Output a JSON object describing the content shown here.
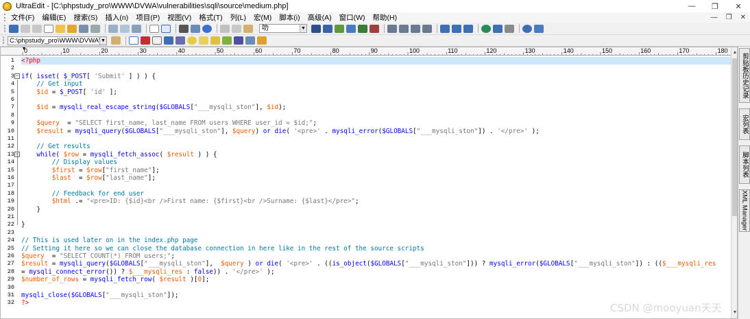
{
  "window": {
    "title": "UltraEdit - [C:\\phpstudy_pro\\WWW\\DVWA\\vulnerabilities\\sqli\\source\\medium.php]",
    "controls": {
      "minimize": "—",
      "restore": "❐",
      "close": "✕"
    }
  },
  "menu": {
    "items": [
      "文件(F)",
      "编辑(E)",
      "搜索(S)",
      "插入(n)",
      "项目(P)",
      "视图(V)",
      "格式(T)",
      "列(L)",
      "宏(M)",
      "脚本(i)",
      "高级(A)",
      "窗口(W)",
      "帮助(H)"
    ],
    "doc_controls": {
      "minimize": "—",
      "restore": "❐",
      "close": "✕"
    }
  },
  "toolbar": {
    "font_select_value": "叻",
    "path_select_value": "C:\\phpstudy_pro\\WWW\\DVWA\\vu"
  },
  "ruler": {
    "labels": [
      "0",
      "10",
      "20",
      "30",
      "40",
      "50",
      "60",
      "70",
      "80",
      "90",
      "100",
      "110",
      "120",
      "130",
      "140",
      "150",
      "160",
      "170",
      "180"
    ]
  },
  "side_tabs": [
    "剪贴板历史记录",
    "宏列表",
    "脚本列表",
    "XML Manager"
  ],
  "code_lines": [
    {
      "n": "1",
      "tokens": [
        {
          "t": "<?php",
          "c": "tag"
        }
      ]
    },
    {
      "n": "2",
      "tokens": []
    },
    {
      "n": "3",
      "tokens": [
        {
          "t": "if",
          "c": "kw"
        },
        {
          "t": "( ",
          "c": "op"
        },
        {
          "t": "isset",
          "c": "fn"
        },
        {
          "t": "( ",
          "c": "op"
        },
        {
          "t": "$_POST",
          "c": "kw"
        },
        {
          "t": "[ ",
          "c": "op"
        },
        {
          "t": "'Submit'",
          "c": "str"
        },
        {
          "t": " ] ) ) {",
          "c": "op"
        }
      ]
    },
    {
      "n": "4",
      "tokens": [
        {
          "t": "    // Get input",
          "c": "cmt"
        }
      ]
    },
    {
      "n": "5",
      "tokens": [
        {
          "t": "    ",
          "c": "op"
        },
        {
          "t": "$id",
          "c": "var"
        },
        {
          "t": " = ",
          "c": "op"
        },
        {
          "t": "$_POST",
          "c": "kw"
        },
        {
          "t": "[ ",
          "c": "op"
        },
        {
          "t": "'id'",
          "c": "str"
        },
        {
          "t": " ];",
          "c": "op"
        }
      ]
    },
    {
      "n": "6",
      "tokens": []
    },
    {
      "n": "7",
      "tokens": [
        {
          "t": "    ",
          "c": "op"
        },
        {
          "t": "$id",
          "c": "var"
        },
        {
          "t": " = ",
          "c": "op"
        },
        {
          "t": "mysqli_real_escape_string",
          "c": "fn"
        },
        {
          "t": "(",
          "c": "op"
        },
        {
          "t": "$GLOBALS",
          "c": "kw"
        },
        {
          "t": "[",
          "c": "op"
        },
        {
          "t": "\"___mysqli_ston\"",
          "c": "str"
        },
        {
          "t": "], ",
          "c": "op"
        },
        {
          "t": "$id",
          "c": "var"
        },
        {
          "t": ");",
          "c": "op"
        }
      ]
    },
    {
      "n": "8",
      "tokens": []
    },
    {
      "n": "9",
      "tokens": [
        {
          "t": "    ",
          "c": "op"
        },
        {
          "t": "$query",
          "c": "var"
        },
        {
          "t": "  = ",
          "c": "op"
        },
        {
          "t": "\"SELECT first_name, last_name FROM users WHERE user_id = $id;\"",
          "c": "str"
        },
        {
          "t": ";",
          "c": "op"
        }
      ]
    },
    {
      "n": "10",
      "tokens": [
        {
          "t": "    ",
          "c": "op"
        },
        {
          "t": "$result",
          "c": "var"
        },
        {
          "t": " = ",
          "c": "op"
        },
        {
          "t": "mysqli_query",
          "c": "fn"
        },
        {
          "t": "(",
          "c": "op"
        },
        {
          "t": "$GLOBALS",
          "c": "kw"
        },
        {
          "t": "[",
          "c": "op"
        },
        {
          "t": "\"___mysqli_ston\"",
          "c": "str"
        },
        {
          "t": "], ",
          "c": "op"
        },
        {
          "t": "$query",
          "c": "var"
        },
        {
          "t": ") ",
          "c": "op"
        },
        {
          "t": "or",
          "c": "kw"
        },
        {
          "t": " ",
          "c": "op"
        },
        {
          "t": "die",
          "c": "fn"
        },
        {
          "t": "( ",
          "c": "op"
        },
        {
          "t": "'<pre>'",
          "c": "str"
        },
        {
          "t": " . ",
          "c": "op"
        },
        {
          "t": "mysqli_error",
          "c": "fn"
        },
        {
          "t": "(",
          "c": "op"
        },
        {
          "t": "$GLOBALS",
          "c": "kw"
        },
        {
          "t": "[",
          "c": "op"
        },
        {
          "t": "\"___mysqli_ston\"",
          "c": "str"
        },
        {
          "t": "]) . ",
          "c": "op"
        },
        {
          "t": "'</pre>'",
          "c": "str"
        },
        {
          "t": " );",
          "c": "op"
        }
      ]
    },
    {
      "n": "11",
      "tokens": []
    },
    {
      "n": "12",
      "tokens": [
        {
          "t": "    // Get results",
          "c": "cmt"
        }
      ]
    },
    {
      "n": "13",
      "tokens": [
        {
          "t": "    ",
          "c": "op"
        },
        {
          "t": "while",
          "c": "kw"
        },
        {
          "t": "( ",
          "c": "op"
        },
        {
          "t": "$row",
          "c": "var"
        },
        {
          "t": " = ",
          "c": "op"
        },
        {
          "t": "mysqli_fetch_assoc",
          "c": "fn"
        },
        {
          "t": "( ",
          "c": "op"
        },
        {
          "t": "$result",
          "c": "var"
        },
        {
          "t": " ) ) {",
          "c": "op"
        }
      ]
    },
    {
      "n": "14",
      "tokens": [
        {
          "t": "        // Display values",
          "c": "cmt"
        }
      ]
    },
    {
      "n": "15",
      "tokens": [
        {
          "t": "        ",
          "c": "op"
        },
        {
          "t": "$first",
          "c": "var"
        },
        {
          "t": " = ",
          "c": "op"
        },
        {
          "t": "$row",
          "c": "var"
        },
        {
          "t": "[",
          "c": "op"
        },
        {
          "t": "\"first_name\"",
          "c": "str"
        },
        {
          "t": "];",
          "c": "op"
        }
      ]
    },
    {
      "n": "16",
      "tokens": [
        {
          "t": "        ",
          "c": "op"
        },
        {
          "t": "$last",
          "c": "var"
        },
        {
          "t": "  = ",
          "c": "op"
        },
        {
          "t": "$row",
          "c": "var"
        },
        {
          "t": "[",
          "c": "op"
        },
        {
          "t": "\"last_name\"",
          "c": "str"
        },
        {
          "t": "];",
          "c": "op"
        }
      ]
    },
    {
      "n": "17",
      "tokens": []
    },
    {
      "n": "18",
      "tokens": [
        {
          "t": "        // Feedback for end user",
          "c": "cmt"
        }
      ]
    },
    {
      "n": "19",
      "tokens": [
        {
          "t": "        ",
          "c": "op"
        },
        {
          "t": "$html",
          "c": "var"
        },
        {
          "t": " .= ",
          "c": "op"
        },
        {
          "t": "\"<pre>ID: {$id}<br />First name: {$first}<br />Surname: {$last}</pre>\"",
          "c": "str"
        },
        {
          "t": ";",
          "c": "op"
        }
      ]
    },
    {
      "n": "20",
      "tokens": [
        {
          "t": "    }",
          "c": "op"
        }
      ]
    },
    {
      "n": "21",
      "tokens": []
    },
    {
      "n": "22",
      "tokens": [
        {
          "t": "}",
          "c": "op"
        }
      ]
    },
    {
      "n": "23",
      "tokens": []
    },
    {
      "n": "24",
      "tokens": [
        {
          "t": "// This is used later on in the index.php page",
          "c": "cmt"
        }
      ]
    },
    {
      "n": "25",
      "tokens": [
        {
          "t": "// Setting it here so we can close the database connection in here like in the rest of the source scripts",
          "c": "cmt"
        }
      ]
    },
    {
      "n": "26",
      "tokens": [
        {
          "t": "$query",
          "c": "var"
        },
        {
          "t": "  = ",
          "c": "op"
        },
        {
          "t": "\"SELECT COUNT(*) FROM users;\"",
          "c": "str"
        },
        {
          "t": ";",
          "c": "op"
        }
      ]
    },
    {
      "n": "27",
      "tokens": [
        {
          "t": "$result",
          "c": "var"
        },
        {
          "t": " = ",
          "c": "op"
        },
        {
          "t": "mysqli_query",
          "c": "fn"
        },
        {
          "t": "(",
          "c": "op"
        },
        {
          "t": "$GLOBALS",
          "c": "kw"
        },
        {
          "t": "[",
          "c": "op"
        },
        {
          "t": "\"___mysqli_ston\"",
          "c": "str"
        },
        {
          "t": "],  ",
          "c": "op"
        },
        {
          "t": "$query",
          "c": "var"
        },
        {
          "t": " ) ",
          "c": "op"
        },
        {
          "t": "or",
          "c": "kw"
        },
        {
          "t": " ",
          "c": "op"
        },
        {
          "t": "die",
          "c": "fn"
        },
        {
          "t": "( ",
          "c": "op"
        },
        {
          "t": "'<pre>'",
          "c": "str"
        },
        {
          "t": " . ((",
          "c": "op"
        },
        {
          "t": "is_object",
          "c": "fn"
        },
        {
          "t": "(",
          "c": "op"
        },
        {
          "t": "$GLOBALS",
          "c": "kw"
        },
        {
          "t": "[",
          "c": "op"
        },
        {
          "t": "\"___mysqli_ston\"",
          "c": "str"
        },
        {
          "t": "])) ? ",
          "c": "op"
        },
        {
          "t": "mysqli_error",
          "c": "fn"
        },
        {
          "t": "(",
          "c": "op"
        },
        {
          "t": "$GLOBALS",
          "c": "kw"
        },
        {
          "t": "[",
          "c": "op"
        },
        {
          "t": "\"___mysqli_ston\"",
          "c": "str"
        },
        {
          "t": "]) : ((",
          "c": "op"
        },
        {
          "t": "$___mysqli_res",
          "c": "var"
        }
      ]
    },
    {
      "n": "28",
      "tokens": [
        {
          "t": "= ",
          "c": "op"
        },
        {
          "t": "mysqli_connect_error",
          "c": "fn"
        },
        {
          "t": "()) ? ",
          "c": "op"
        },
        {
          "t": "$___mysqli_res",
          "c": "var"
        },
        {
          "t": " : ",
          "c": "op"
        },
        {
          "t": "false",
          "c": "kw"
        },
        {
          "t": ")) . ",
          "c": "op"
        },
        {
          "t": "'</pre>'",
          "c": "str"
        },
        {
          "t": " );",
          "c": "op"
        }
      ]
    },
    {
      "n": "29",
      "tokens": [
        {
          "t": "$number_of_rows",
          "c": "var"
        },
        {
          "t": " = ",
          "c": "op"
        },
        {
          "t": "mysqli_fetch_row",
          "c": "fn"
        },
        {
          "t": "( ",
          "c": "op"
        },
        {
          "t": "$result",
          "c": "var"
        },
        {
          "t": " )[",
          "c": "op"
        },
        {
          "t": "0",
          "c": "var"
        },
        {
          "t": "];",
          "c": "op"
        }
      ]
    },
    {
      "n": "30",
      "tokens": []
    },
    {
      "n": "31",
      "tokens": [
        {
          "t": "mysqli_close",
          "c": "fn"
        },
        {
          "t": "(",
          "c": "op"
        },
        {
          "t": "$GLOBALS",
          "c": "kw"
        },
        {
          "t": "[",
          "c": "op"
        },
        {
          "t": "\"___mysqli_ston\"",
          "c": "str"
        },
        {
          "t": "]);",
          "c": "op"
        }
      ]
    },
    {
      "n": "32",
      "tokens": [
        {
          "t": "?>",
          "c": "tag"
        }
      ]
    }
  ],
  "folds": [
    "3",
    "13"
  ],
  "watermark": "CSDN @mooyuan天天"
}
